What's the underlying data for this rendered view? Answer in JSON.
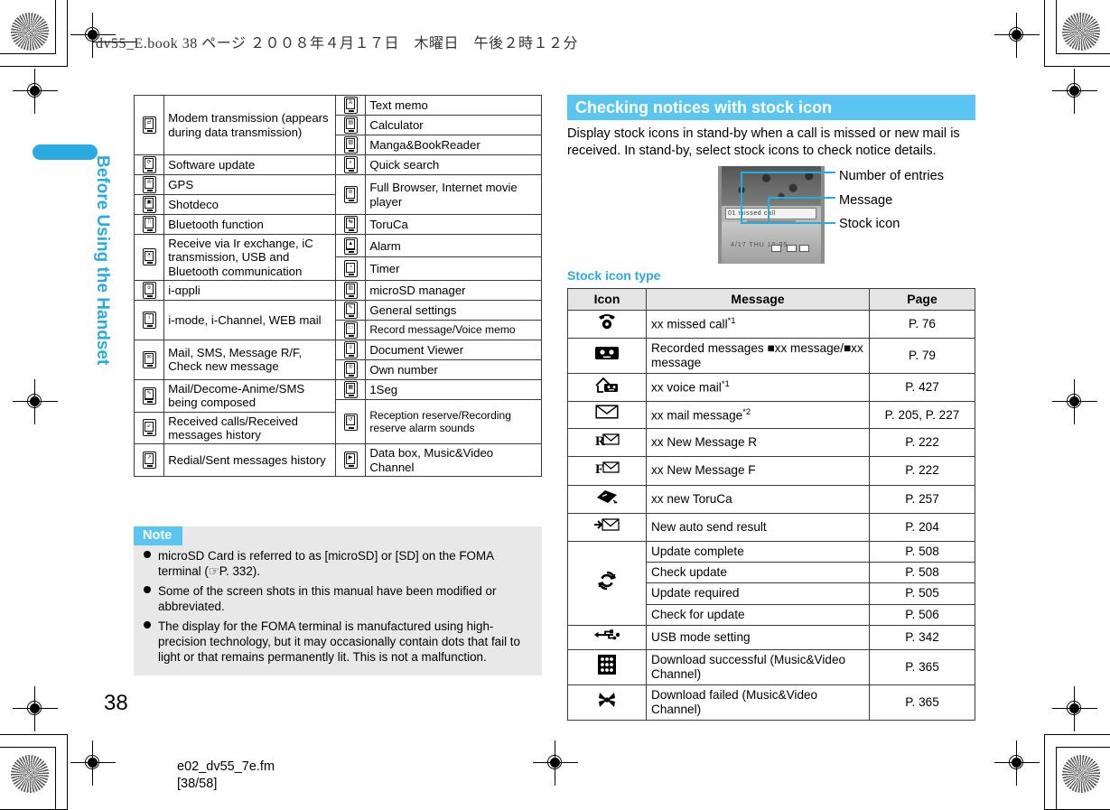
{
  "print_header": "dv55_E.book  38 ページ  ２００８年４月１７日　木曜日　午後２時１２分",
  "sidebar": {
    "chapter_label": "Before Using the Handset"
  },
  "page_number": "38",
  "footer": {
    "filename": "e02_dv55_7e.fm",
    "page_range": "[38/58]"
  },
  "icon_table": {
    "rows": [
      {
        "icon": "modem-transmission-icon",
        "glyph": "⇄",
        "left": "Modem transmission (appears during data transmission)",
        "icon2": "text-memo-icon",
        "glyph2": "A",
        "right": "Text memo"
      },
      {
        "icon": "software-update-icon",
        "glyph": "⟳",
        "left": "Software update",
        "icon2": "calculator-icon",
        "glyph2": "▤",
        "right": "Calculator"
      },
      {
        "icon": "gps-icon",
        "glyph": "✇",
        "left": "GPS",
        "icon2": "manga-bookreader-icon",
        "glyph2": "▧",
        "right": "Manga&BookReader"
      },
      {
        "icon": "shotdeco-icon",
        "glyph": "▣",
        "left": "Shotdeco",
        "icon2": "quick-search-icon",
        "glyph2": "⌕",
        "right": "Quick search"
      },
      {
        "icon": "bluetooth-function-icon",
        "glyph": "ᛦ",
        "left": "Bluetooth function",
        "icon2": "full-browser-icon",
        "glyph2": "⊘",
        "right": "Full Browser, Internet movie player"
      },
      {
        "icon": "ir-exchange-icon",
        "glyph": "⦿",
        "left": "Receive via Ir exchange, iC transmission, USB and Bluetooth communication",
        "icon2": "toruca-icon",
        "glyph2": "↹",
        "right": "ToruCa"
      },
      {
        "icon": "i-appli-icon",
        "glyph": "α",
        "left": "i-αppli",
        "icon2": "alarm-icon",
        "glyph2": "⏰",
        "right": "Alarm"
      },
      {
        "icon": "i-mode-icon",
        "glyph": "i",
        "left": "i-mode, i-Channel, WEB mail",
        "icon2": "timer-icon",
        "glyph2": "◔",
        "right": "Timer"
      },
      {
        "icon": "mail-sms-icon",
        "glyph": "✉",
        "left": "Mail, SMS, Message R/F, Check new message",
        "icon2": "microsd-manager-icon",
        "glyph2": "▥",
        "right": "microSD manager"
      },
      {
        "icon": "mail-composing-icon",
        "glyph": "✎",
        "left": "Mail/Decome-Anime/SMS being composed",
        "icon2": "general-settings-icon",
        "glyph2": "⚙",
        "right": "General settings"
      },
      {
        "icon": "received-calls-icon",
        "glyph": "↙",
        "left": "Received calls/Received messages history",
        "icon2": "record-message-icon",
        "glyph2": "▢",
        "right": "Record message/Voice memo"
      },
      {
        "icon": "redial-icon",
        "glyph": "↗",
        "left": "Redial/Sent messages history",
        "icon2": "document-viewer-icon",
        "glyph2": "≡",
        "right": "Document Viewer"
      },
      {
        "icon": "",
        "glyph": "",
        "left": "",
        "icon2": "own-number-icon",
        "glyph2": "①",
        "right": "Own number"
      },
      {
        "icon": "",
        "glyph": "",
        "left": "",
        "icon2": "oneseg-icon",
        "glyph2": "▦",
        "right": "1Seg"
      },
      {
        "icon": "",
        "glyph": "",
        "left": "",
        "icon2": "reception-reserve-icon",
        "glyph2": "↺",
        "right": "Reception reserve/Recording reserve alarm sounds"
      },
      {
        "icon": "",
        "glyph": "",
        "left": "",
        "icon2": "data-box-icon",
        "glyph2": "▶",
        "right": "Data box, Music&Video Channel"
      }
    ]
  },
  "note": {
    "title": "Note",
    "items": [
      "microSD Card is referred to as [microSD] or [SD] on the FOMA terminal (☞P. 332).",
      "Some of the screen shots in this manual have been modified or abbreviated.",
      "The display for the FOMA terminal is manufactured using high-precision technology, but it may occasionally contain dots that fail to light or that remains permanently lit. This is not a malfunction."
    ]
  },
  "section": {
    "heading": "Checking notices with stock icon",
    "intro": "Display stock icons in stand-by when a call is missed or new mail is received. In stand-by, select stock icons to check notice details.",
    "callouts": [
      "Number of entries",
      "Message",
      "Stock icon"
    ],
    "screenshot": {
      "status_text": "01 missed call",
      "clock_text": "4/17 THU 10:05"
    },
    "subheading": "Stock icon type"
  },
  "stock_table": {
    "headers": [
      "Icon",
      "Message",
      "Page"
    ],
    "rows": [
      {
        "icon": "missed-call-icon",
        "message": "xx missed call",
        "sup": "*1",
        "page": "P. 76",
        "rowspan": 1
      },
      {
        "icon": "recorded-messages-icon",
        "message": "Recorded messages ■xx message/■xx message",
        "sup": "",
        "page": "P. 79",
        "rowspan": 1
      },
      {
        "icon": "voice-mail-icon",
        "message": "xx voice mail",
        "sup": "*1",
        "page": "P. 427",
        "rowspan": 1
      },
      {
        "icon": "mail-message-icon",
        "message": "xx mail message",
        "sup": "*2",
        "page": "P. 205, P. 227",
        "rowspan": 1
      },
      {
        "icon": "new-message-r-icon",
        "message": "xx New Message R",
        "sup": "",
        "page": "P. 222",
        "rowspan": 1
      },
      {
        "icon": "new-message-f-icon",
        "message": "xx New Message F",
        "sup": "",
        "page": "P. 222",
        "rowspan": 1
      },
      {
        "icon": "new-toruca-icon",
        "message": "xx new ToruCa",
        "sup": "",
        "page": "P. 257",
        "rowspan": 1
      },
      {
        "icon": "auto-send-result-icon",
        "message": "New auto send result",
        "sup": "",
        "page": "P. 204",
        "rowspan": 1
      },
      {
        "icon": "software-update-icon",
        "message": "Update complete",
        "sup": "",
        "page": "P. 508",
        "rowspan": 4
      },
      {
        "icon": "",
        "message": "Check update",
        "sup": "",
        "page": "P. 508",
        "rowspan": 0
      },
      {
        "icon": "",
        "message": "Update required",
        "sup": "",
        "page": "P. 505",
        "rowspan": 0
      },
      {
        "icon": "",
        "message": "Check for update",
        "sup": "",
        "page": "P. 506",
        "rowspan": 0
      },
      {
        "icon": "usb-mode-icon",
        "message": "USB mode setting",
        "sup": "",
        "page": "P. 342",
        "rowspan": 1
      },
      {
        "icon": "download-success-icon",
        "message": "Download successful (Music&Video Channel)",
        "sup": "",
        "page": "P. 365",
        "rowspan": 1
      },
      {
        "icon": "download-failed-icon",
        "message": "Download failed (Music&Video Channel)",
        "sup": "",
        "page": "P. 365",
        "rowspan": 1
      }
    ]
  },
  "colors": {
    "accent_blue": "#5BC5F2",
    "tab_blue": "#29ABE2",
    "note_bg": "#e8e8e8",
    "table_header_bg": "#e4e4e4"
  }
}
